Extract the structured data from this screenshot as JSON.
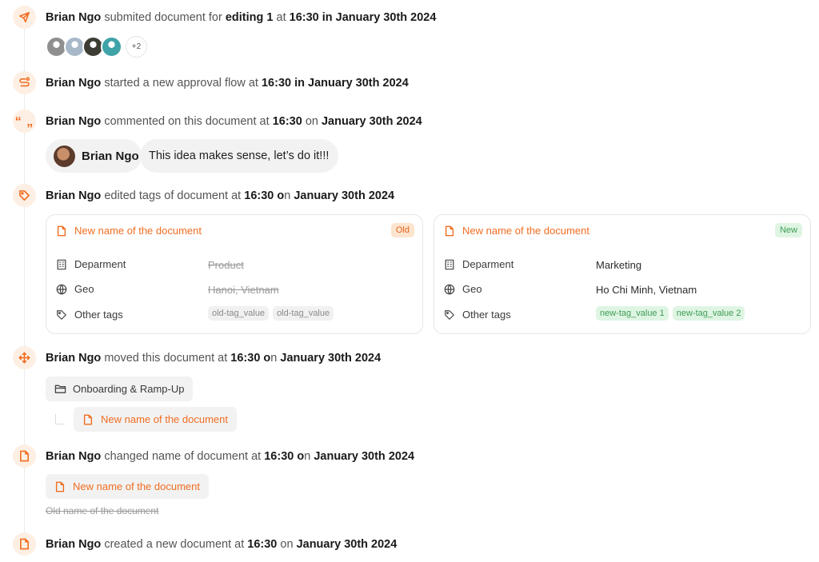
{
  "events": {
    "submitted": {
      "user": "Brian Ngo",
      "action": "submited document for",
      "target": "editing 1",
      "at_word": "at",
      "time": "16:30",
      "in_word": "in",
      "date": "January 30th 2024",
      "extra_count": "+2",
      "avatar_colors": [
        "#8f8f8f",
        "#a7b9c9",
        "#3d3d33",
        "#3fa3a8"
      ]
    },
    "approval": {
      "user": "Brian Ngo",
      "action": "started a new approval flow at",
      "time": "16:30",
      "in_word": "in",
      "date": "January 30th 2024"
    },
    "comment": {
      "user": "Brian Ngo",
      "action": "commented on this document at",
      "time": "16:30",
      "on_word": "on",
      "date": "January 30th 2024",
      "author": "Brian Ngo",
      "text": "This idea makes sense, let’s do it!!!"
    },
    "tags": {
      "user": "Brian Ngo",
      "action": "edited tags of document at",
      "time": "16:30",
      "o_word": "o",
      "n_word": "n",
      "date": "January 30th 2024",
      "labels": {
        "department": "Deparment",
        "geo": "Geo",
        "other": "Other tags"
      },
      "old": {
        "title": "New name of the document",
        "badge": "Old",
        "department": "Product",
        "geo": "Hanoi, Vietnam",
        "tags": [
          "old-tag_value",
          "old-tag_value"
        ]
      },
      "new": {
        "title": "New name of the document",
        "badge": "New",
        "department": "Marketing",
        "geo": "Ho Chi Minh, Vietnam",
        "tags": [
          "new-tag_value 1",
          "new-tag_value 2"
        ]
      }
    },
    "moved": {
      "user": "Brian Ngo",
      "action": "moved this document at",
      "time": "16:30",
      "o_word": "o",
      "n_word": "n",
      "date": "January 30th 2024",
      "folder": "Onboarding & Ramp-Up",
      "document": "New name of the document"
    },
    "renamed": {
      "user": "Brian Ngo",
      "action": "changed name of document at",
      "time": "16:30",
      "o_word": "o",
      "n_word": "n",
      "date": "January 30th 2024",
      "new_name": "New name of the document",
      "old_name": "Old name of the document"
    },
    "created": {
      "user": "Brian Ngo",
      "action": "created a new document at",
      "time": "16:30",
      "on_word": "on",
      "date": "January 30th 2024"
    }
  },
  "icons": {
    "submitted": "send-icon",
    "approval": "flow-icon",
    "comment": "quote-icon",
    "tags": "tag-icon",
    "moved": "move-icon",
    "renamed": "document-icon",
    "created": "document-icon"
  },
  "colors": {
    "accent": "#f06d22",
    "accent_bg": "#fdefe3",
    "success": "#3d9d54"
  }
}
